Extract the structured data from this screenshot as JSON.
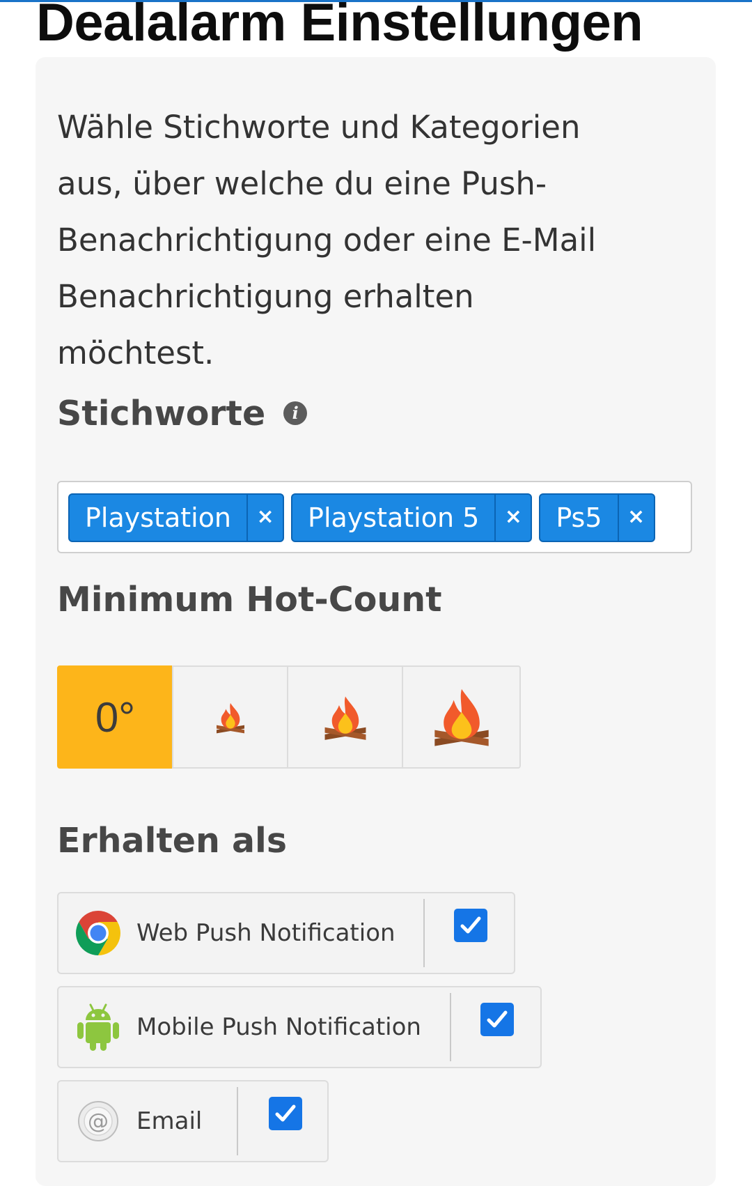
{
  "page": {
    "title": "Dealalarm Einstellungen",
    "intro": "Wähle Stichworte und Kategorien aus, über welche du eine Push-Benachrichtigung oder eine E-Mail Benachrichtigung erhalten möchtest."
  },
  "keywords": {
    "title": "Stichworte",
    "info_icon": "info-icon",
    "tags": [
      {
        "label": "Playstation",
        "remove": "×"
      },
      {
        "label": "Playstation 5",
        "remove": "×"
      },
      {
        "label": "Ps5",
        "remove": "×"
      }
    ]
  },
  "hot_count": {
    "title": "Minimum Hot-Count",
    "selected_label": "0°",
    "options": [
      "0°",
      "small-fire-icon",
      "medium-fire-icon",
      "large-fire-icon"
    ],
    "active_color": "#fdb51a"
  },
  "receive": {
    "title": "Erhalten als",
    "channels": [
      {
        "label": "Web Push Notification",
        "icon": "chrome-icon",
        "checked": true
      },
      {
        "label": "Mobile Push Notification",
        "icon": "android-icon",
        "checked": true
      },
      {
        "label": "Email",
        "icon": "at-sign-icon",
        "checked": true
      }
    ]
  },
  "colors": {
    "tag_blue": "#1b88e3",
    "checkbox_blue": "#1575e6",
    "card_bg": "#f6f6f6"
  }
}
